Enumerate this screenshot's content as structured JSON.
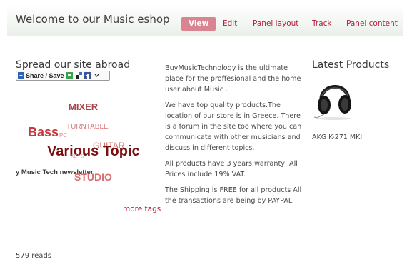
{
  "header": {
    "site_title": "Welcome to our Music eshop",
    "tabs": [
      {
        "label": "View",
        "active": true
      },
      {
        "label": "Edit",
        "active": false
      },
      {
        "label": "Panel layout",
        "active": false
      },
      {
        "label": "Track",
        "active": false
      },
      {
        "label": "Panel content",
        "active": false
      }
    ]
  },
  "left": {
    "spread_title": "Spread our site abroad",
    "share_label": "Share / Save",
    "tags": [
      {
        "text": "MIXER",
        "color": "#a6464a"
      },
      {
        "text": "TURNTABLE",
        "color": "#d97777"
      },
      {
        "text": "Bass",
        "color": "#c9383d"
      },
      {
        "text": "PC",
        "color": "#dd8f8f"
      },
      {
        "text": "GUITAR",
        "color": "#d97777"
      },
      {
        "text": "Various Topic",
        "color": "#7a0f12"
      },
      {
        "text": "KEYS",
        "color": "#e2a7a7"
      },
      {
        "text": "y Music Tech newsletter",
        "color": "#3a3a3a"
      },
      {
        "text": "STUDIO",
        "color": "#d96d6d"
      }
    ],
    "more_tags": "more tags",
    "reads": "579 reads"
  },
  "content": {
    "paragraphs": [
      "BuyMusicTechnology is the ultimate place for the proffesional and the home user about Music .",
      "We have top quality products.The location of our store is in Greece. There is a forum in the site too where you can communicate with other musicians and discuss in different topics.",
      "All products have 3 years warranty .All Prices include 19% VAT.",
      "The Shipping is FREE for all products All the transactions are being by PAYPAL"
    ]
  },
  "latest": {
    "title": "Latest Products",
    "product_name": "AKG K-271 MKII"
  },
  "colors": {
    "accent": "#b0213f",
    "active_tab_bg": "#d98491"
  }
}
